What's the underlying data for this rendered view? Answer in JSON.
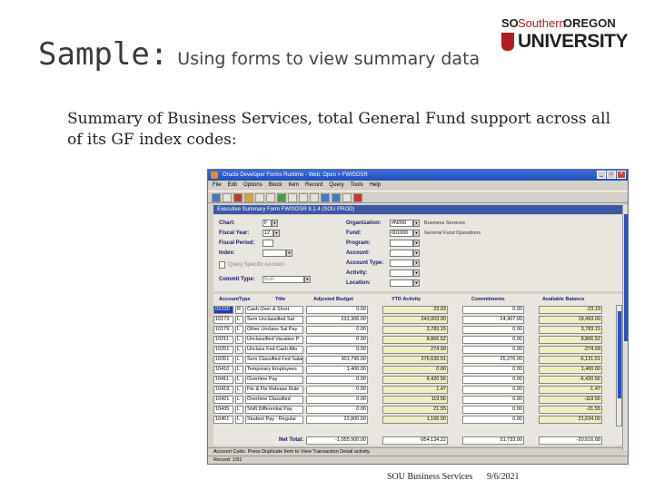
{
  "slide": {
    "title_main": "Sample:",
    "title_sub": "Using forms to view summary data",
    "bullet_icon": "",
    "bullet_text": "Summary of Business Services, total General Fund support across all of its GF index codes:",
    "footer_org": "SOU Business Services",
    "footer_date": "9/6/2021"
  },
  "logo": {
    "line1_a": "SO",
    "line1_b": "Southern",
    "line1_c": "OREGON",
    "line2": "UNIVERSITY",
    "brand_color": "#b11b25"
  },
  "window": {
    "title": "Oracle Developer Forms Runtime - Web: Open > FWISOSR",
    "menu": [
      "File",
      "Edit",
      "Options",
      "Block",
      "Item",
      "Record",
      "Query",
      "Tools",
      "Help"
    ],
    "form_title": "Executive Summary Form FWISOSR 8.1.4 (SOU PROD)",
    "fields": {
      "chart_label": "Chart:",
      "chart_value": "F",
      "fiscal_year_label": "Fiscal Year:",
      "fiscal_year_value": "12",
      "fiscal_period_label": "Fiscal Period:",
      "index_label": "Index:",
      "query_specific_label": "Query Specific Account",
      "commit_type_label": "Commit Type:",
      "commit_type_value": "Both",
      "organization_label": "Organization:",
      "organization_value": "#N000",
      "organization_desc": "Business Services",
      "fund_label": "Fund:",
      "fund_value": "001000",
      "fund_desc": "General Fund Operations",
      "program_label": "Program:",
      "account_label": "Account:",
      "account_type_label": "Account Type:",
      "activity_label": "Activity:",
      "location_label": "Location:"
    },
    "grid": {
      "headers": [
        "Account",
        "Type",
        "Title",
        "Adjusted Budget",
        "YTD Activity",
        "Commitments",
        "Available Balance"
      ],
      "rows": [
        [
          "0X220",
          "R",
          "Cash Over & Short",
          "0.00",
          "23.03",
          "0.00",
          "-23.19"
        ],
        [
          "10173",
          "L",
          "Sem Unclassified Sal",
          "231,306.00",
          "243,003.00",
          "24,407.00",
          "19,493.00"
        ],
        [
          "10179",
          "L",
          "Other Unclass Sal Pay",
          "0.00",
          "3,783.15",
          "0.00",
          "3,783.15"
        ],
        [
          "10211",
          "L",
          "Unclassified Vacation P",
          "0.00",
          "8,866.52",
          "0.00",
          "8,866.52"
        ],
        [
          "10251",
          "L",
          "Unclass Fed Cash Allo",
          "0.00",
          "274.99",
          "0.00",
          "-274.99"
        ],
        [
          "10351",
          "L",
          "Sem Classified Fed Salary",
          "301,795.00",
          "276,639.51",
          "25,276.00",
          "-5,121.51"
        ],
        [
          "10410",
          "L",
          "Temporary Employees",
          "1,400.00",
          "0.00",
          "0.00",
          "1,400.00"
        ],
        [
          "10411",
          "L",
          "Overtime Pay",
          "0.00",
          "6,420.56",
          "0.00",
          "-6,420.56"
        ],
        [
          "10419",
          "L",
          "Fte & Fte Release Rule",
          "0.00",
          "1.47",
          "0.00",
          "-1.47"
        ],
        [
          "10421",
          "L",
          "Overtime Classified",
          "0.00",
          "119.56",
          "0.00",
          "-119.56"
        ],
        [
          "10435",
          "L",
          "Shift Differential Pay",
          "0.00",
          "21.55",
          "0.00",
          "-21.55"
        ],
        [
          "10451",
          "L",
          "Student Pay - Regular",
          "22,800.00",
          "1,166.00",
          "0.00",
          "21,634.00"
        ]
      ],
      "net_total_label": "Net Total:",
      "net_total_values": [
        "-1,055,900.00",
        "-954,134.22",
        "51,733.00",
        "-20,616.68"
      ]
    },
    "status_line1": "Account Code. Press Duplicate Item to View Transaction Detail activity.",
    "status_line2": "Record: 1/51"
  }
}
